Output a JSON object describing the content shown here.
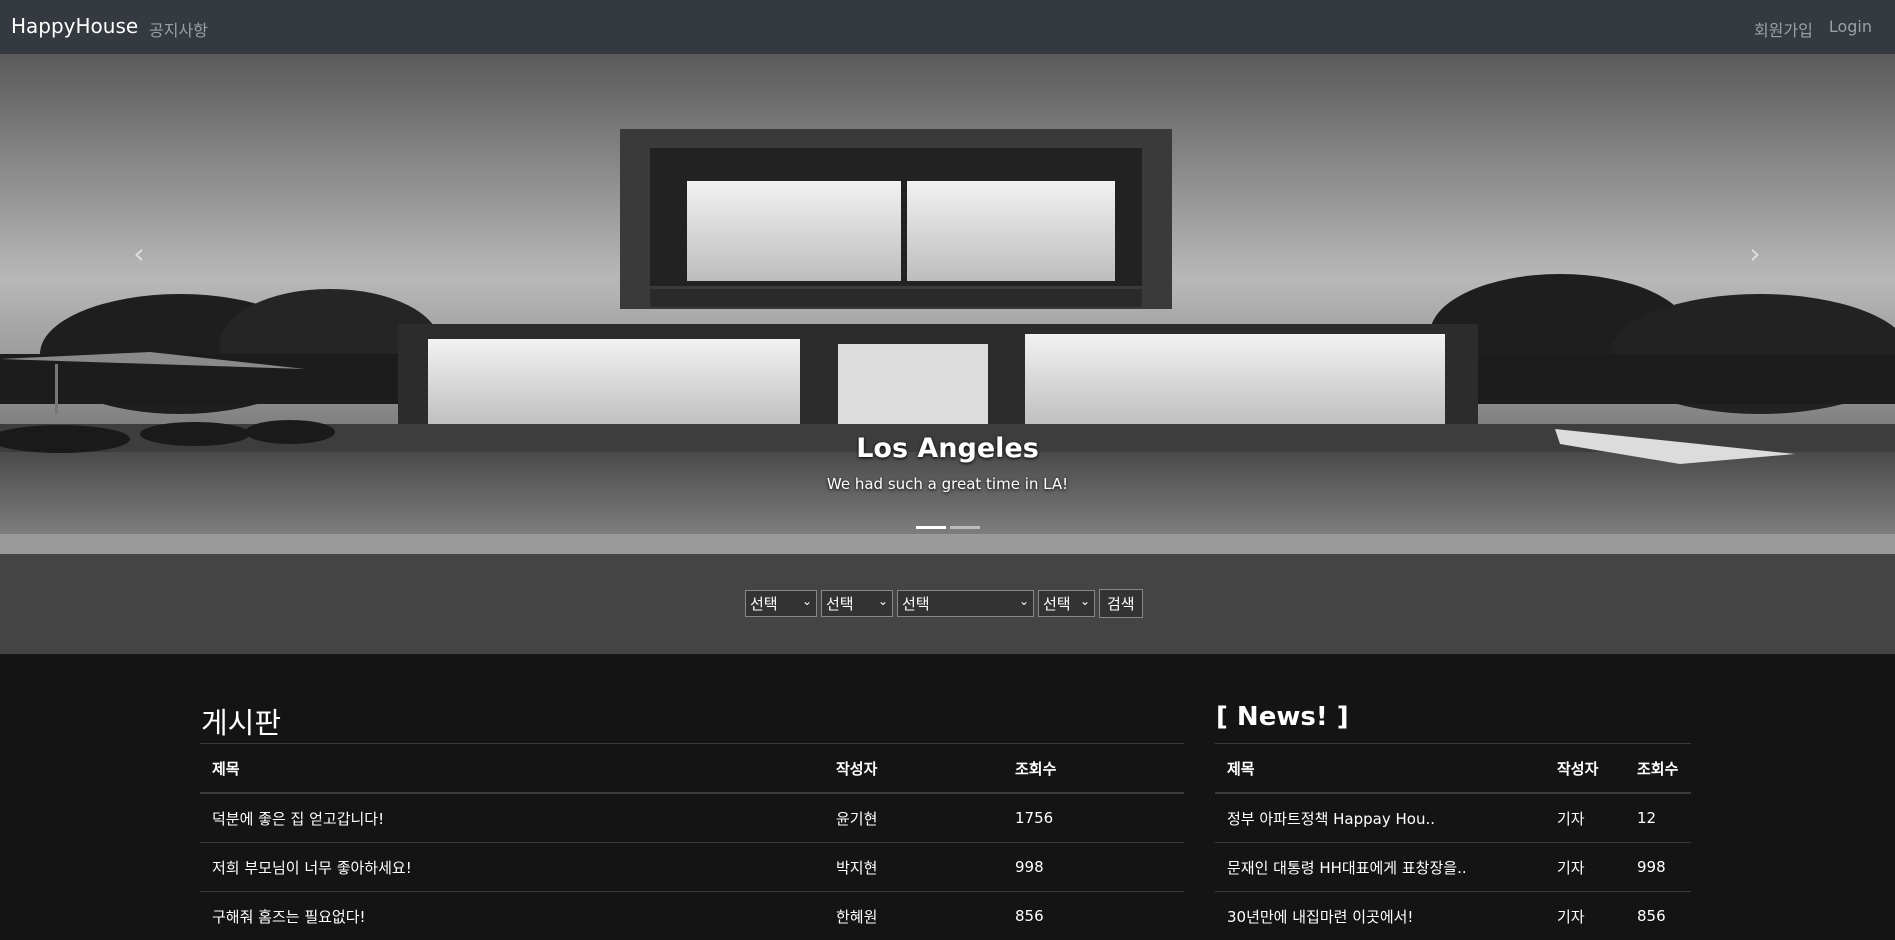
{
  "navbar": {
    "brand": "HappyHouse",
    "notice": "공지사항",
    "signup": "회원가입",
    "login": "Login"
  },
  "hero": {
    "title": "Los Angeles",
    "subtitle": "We had such a great time in LA!",
    "prev_icon": "chevron-left-icon",
    "next_icon": "chevron-right-icon"
  },
  "search": {
    "select1": "선택",
    "select2": "선택",
    "select3": "선택",
    "select4": "선택",
    "button": "검색"
  },
  "board": {
    "title": "게시판",
    "headers": [
      "제목",
      "작성자",
      "조회수"
    ],
    "rows": [
      {
        "title": "덕분에 좋은 집 얻고갑니다!",
        "author": "윤기현",
        "views": "1756"
      },
      {
        "title": "저희 부모님이 너무 좋아하세요!",
        "author": "박지현",
        "views": "998"
      },
      {
        "title": "구해줘 홈즈는 필요없다!",
        "author": "한혜원",
        "views": "856"
      }
    ]
  },
  "news": {
    "title": "[ News! ]",
    "headers": [
      "제목",
      "작성자",
      "조회수"
    ],
    "rows": [
      {
        "title": "정부 아파트정책 Happay Hou..",
        "author": "기자",
        "views": "12"
      },
      {
        "title": "문재인 대통령 HH대표에게 표창장을..",
        "author": "기자",
        "views": "998"
      },
      {
        "title": "30년만에 내집마련 이곳에서!",
        "author": "기자",
        "views": "856"
      }
    ]
  }
}
